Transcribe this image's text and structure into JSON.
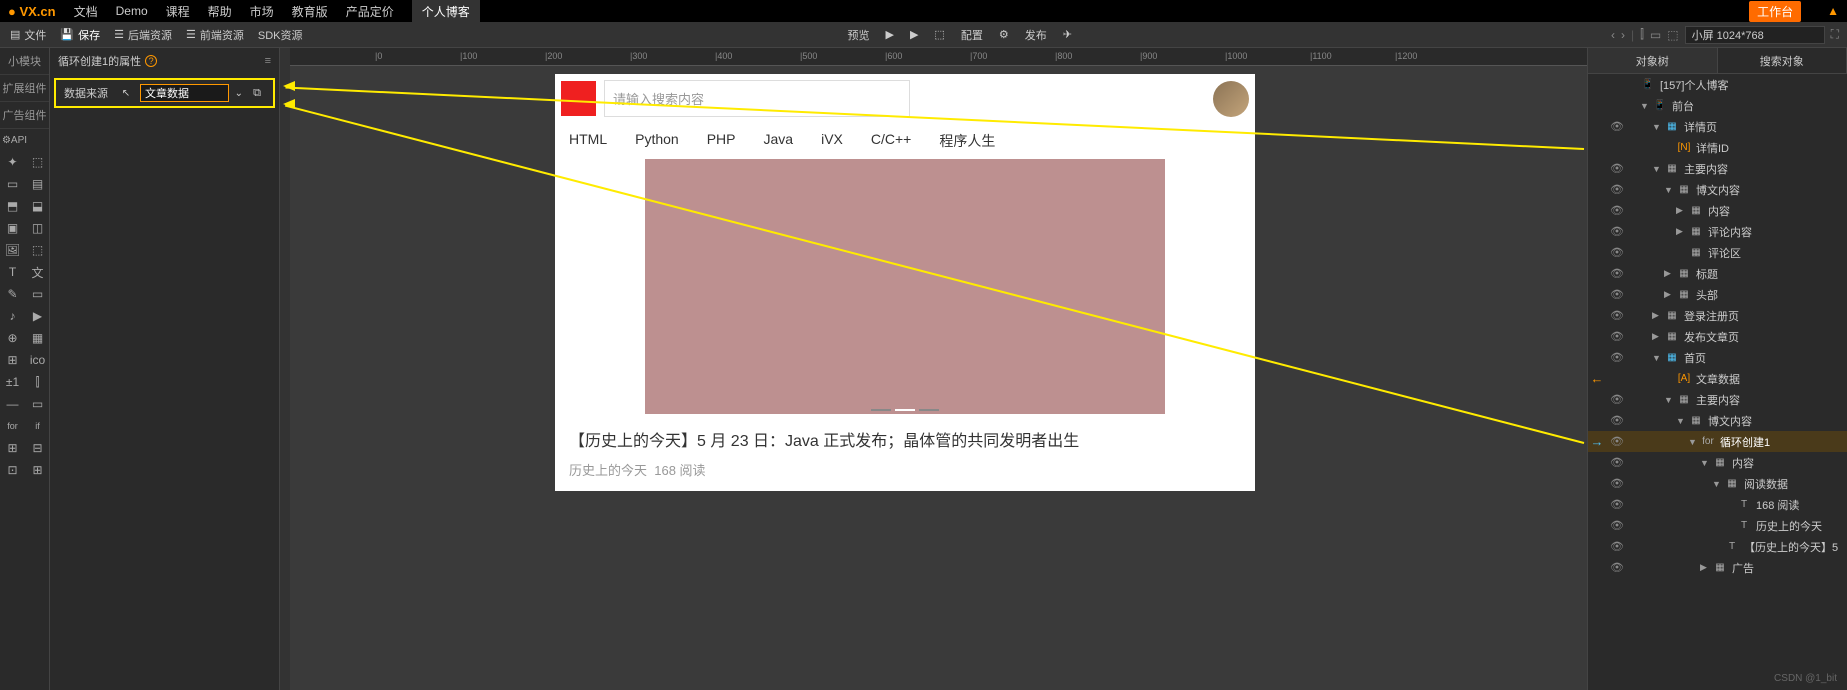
{
  "topbar": {
    "logo": "VX.cn",
    "nav": [
      "文档",
      "Demo",
      "课程",
      "帮助",
      "市场",
      "教育版",
      "产品定价",
      "个人博客"
    ],
    "work_btn": "工作台"
  },
  "toolbar": {
    "left": {
      "file": "文件",
      "save": "保存",
      "backend": "后端资源",
      "frontend": "前端资源",
      "sdk": "SDK资源"
    },
    "center": {
      "preview": "预览",
      "config": "配置",
      "publish": "发布"
    },
    "right": {
      "screen": "小屏 1024*768"
    }
  },
  "left_cats": [
    "小模块",
    "扩展组件",
    "广告组件"
  ],
  "api_label": "API",
  "props": {
    "title": "循环创建1的属性",
    "row_label": "数据来源",
    "row_value": "文章数据"
  },
  "ruler_ticks": [
    0,
    100,
    200,
    300,
    400,
    500,
    600,
    700,
    800,
    900,
    1000,
    1100,
    1200
  ],
  "preview": {
    "search_placeholder": "请输入搜索内容",
    "nav": [
      "HTML",
      "Python",
      "PHP",
      "Java",
      "iVX",
      "C/C++",
      "程序人生"
    ],
    "article_title": "【历史上的今天】5 月 23 日：Java 正式发布；晶体管的共同发明者出生",
    "article_cat": "历史上的今天",
    "article_reads": "168 阅读"
  },
  "right_tabs": {
    "tree": "对象树",
    "search": "搜索对象"
  },
  "tree": [
    {
      "indent": 0,
      "icon": "📱",
      "label": "[157]个人博客",
      "eye": false,
      "caret": ""
    },
    {
      "indent": 1,
      "icon": "📱",
      "label": "前台",
      "eye": false,
      "caret": "▼"
    },
    {
      "indent": 2,
      "icon": "▦",
      "label": "详情页",
      "eye": true,
      "caret": "▼",
      "iconColor": "blue"
    },
    {
      "indent": 3,
      "icon": "[N]",
      "label": "详情ID",
      "eye": false,
      "caret": "",
      "iconColor": "orange",
      "annot": "src1"
    },
    {
      "indent": 2,
      "icon": "▦",
      "label": "主要内容",
      "eye": true,
      "caret": "▼"
    },
    {
      "indent": 3,
      "icon": "▦",
      "label": "博文内容",
      "eye": true,
      "caret": "▼"
    },
    {
      "indent": 4,
      "icon": "▦",
      "label": "内容",
      "eye": true,
      "caret": "▶"
    },
    {
      "indent": 4,
      "icon": "▦",
      "label": "评论内容",
      "eye": true,
      "caret": "▶"
    },
    {
      "indent": 4,
      "icon": "▦",
      "label": "评论区",
      "eye": true,
      "caret": ""
    },
    {
      "indent": 3,
      "icon": "▦",
      "label": "标题",
      "eye": true,
      "caret": "▶"
    },
    {
      "indent": 3,
      "icon": "▦",
      "label": "头部",
      "eye": true,
      "caret": "▶"
    },
    {
      "indent": 2,
      "icon": "▦",
      "label": "登录注册页",
      "eye": true,
      "caret": "▶"
    },
    {
      "indent": 2,
      "icon": "▦",
      "label": "发布文章页",
      "eye": true,
      "caret": "▶"
    },
    {
      "indent": 2,
      "icon": "▦",
      "label": "首页",
      "eye": true,
      "caret": "▼",
      "iconColor": "blue"
    },
    {
      "indent": 3,
      "icon": "[A]",
      "label": "文章数据",
      "eye": false,
      "caret": "",
      "iconColor": "orange",
      "back": true
    },
    {
      "indent": 3,
      "icon": "▦",
      "label": "主要内容",
      "eye": true,
      "caret": "▼"
    },
    {
      "indent": 4,
      "icon": "▦",
      "label": "博文内容",
      "eye": true,
      "caret": "▼"
    },
    {
      "indent": 5,
      "icon": "for",
      "label": "循环创建1",
      "eye": true,
      "caret": "▼",
      "selected": true,
      "fwd": true,
      "annot": "src2"
    },
    {
      "indent": 6,
      "icon": "▦",
      "label": "内容",
      "eye": true,
      "caret": "▼"
    },
    {
      "indent": 7,
      "icon": "▦",
      "label": "阅读数据",
      "eye": true,
      "caret": "▼"
    },
    {
      "indent": 8,
      "icon": "T",
      "label": "168 阅读",
      "eye": true,
      "caret": ""
    },
    {
      "indent": 8,
      "icon": "T",
      "label": "历史上的今天",
      "eye": true,
      "caret": ""
    },
    {
      "indent": 7,
      "icon": "T",
      "label": "【历史上的今天】5",
      "eye": true,
      "caret": ""
    },
    {
      "indent": 6,
      "icon": "▦",
      "label": "广告",
      "eye": true,
      "caret": "▶"
    }
  ],
  "watermark": "CSDN @1_bit"
}
